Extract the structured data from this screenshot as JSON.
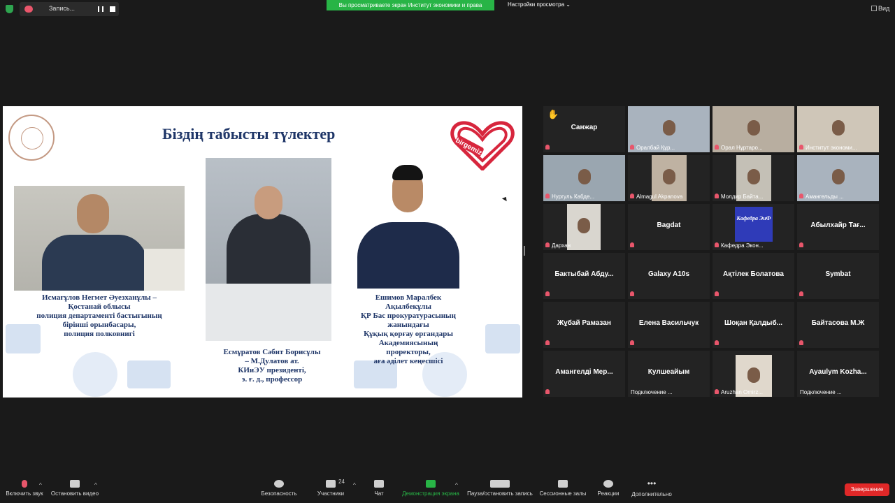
{
  "top": {
    "recording_label": "Запись...",
    "share_banner": "Вы просматриваете экран Институт экономики и права",
    "view_options": "Настройки просмотра",
    "view_label": "Вид"
  },
  "slide": {
    "title": "Біздің табысты түлектер",
    "brand": "birgemiz",
    "caption1": [
      "Исмағұлов Негмет Әуезханұлы –",
      "Қостанай облысы",
      "полиция департаменті бастығының",
      "бірінші орынбасары,",
      "полиция полковнигі"
    ],
    "caption2": [
      "Есмұратов Сәбит Борисұлы",
      "– М.Дулатов ат.",
      "КИиЭУ президенті,",
      "э. ғ. д., профессор"
    ],
    "caption3": [
      "Ешимов Маралбек",
      "Ақылбекұлы",
      "ҚР Бас прокуратурасының",
      "жанындағы",
      "Құқық қорғау органдары",
      "Академиясының",
      "проректоры,",
      "аға әділет кеңесшісі"
    ]
  },
  "participants": [
    {
      "name": "Санжар",
      "hand": true
    },
    {
      "name": "Оралбай Құр...",
      "video": true
    },
    {
      "name": "Орал Нұртаро...",
      "video": true
    },
    {
      "name": "Институт экономи...",
      "video": true,
      "active": true
    },
    {
      "name": "Нургуль Кабде...",
      "video": true
    },
    {
      "name": "Almagul Akpanova",
      "video": true
    },
    {
      "name": "Молдир Байта...",
      "video": true
    },
    {
      "name": "Амангельды ...",
      "video": true
    },
    {
      "name": "Дархан",
      "video": true
    },
    {
      "name": "Bagdat"
    },
    {
      "name": "Кафедра Экон...",
      "video": true,
      "logo": "Кафедра ЭиФ"
    },
    {
      "name": "Абылхайр Тағ..."
    },
    {
      "name": "Бактыбай Абду..."
    },
    {
      "name": "Galaxy A10s"
    },
    {
      "name": "Ақтілек Болатова"
    },
    {
      "name": "Symbat"
    },
    {
      "name": "Жұбай Рамазан"
    },
    {
      "name": "Елена Васильчук"
    },
    {
      "name": "Шоқан Қалдыб..."
    },
    {
      "name": "Байтасова М.Ж"
    },
    {
      "name": "Амангелді Мер..."
    },
    {
      "name": "Кулшеайым",
      "status": "Подключение ..."
    },
    {
      "name": "Aruzhan Omirz...",
      "video": true
    },
    {
      "name": "Ayaulym Kozha...",
      "status": "Подключение ..."
    }
  ],
  "toolbar": {
    "mute": "Включить звук",
    "video": "Остановить видео",
    "security": "Безопасность",
    "participants": "Участники",
    "participants_count": "24",
    "chat": "Чат",
    "share": "Демонстрация экрана",
    "pause_record": "Пауза/остановить запись",
    "breakout": "Сессионные залы",
    "reactions": "Реакции",
    "more": "Дополнительно",
    "end": "Завершение"
  }
}
